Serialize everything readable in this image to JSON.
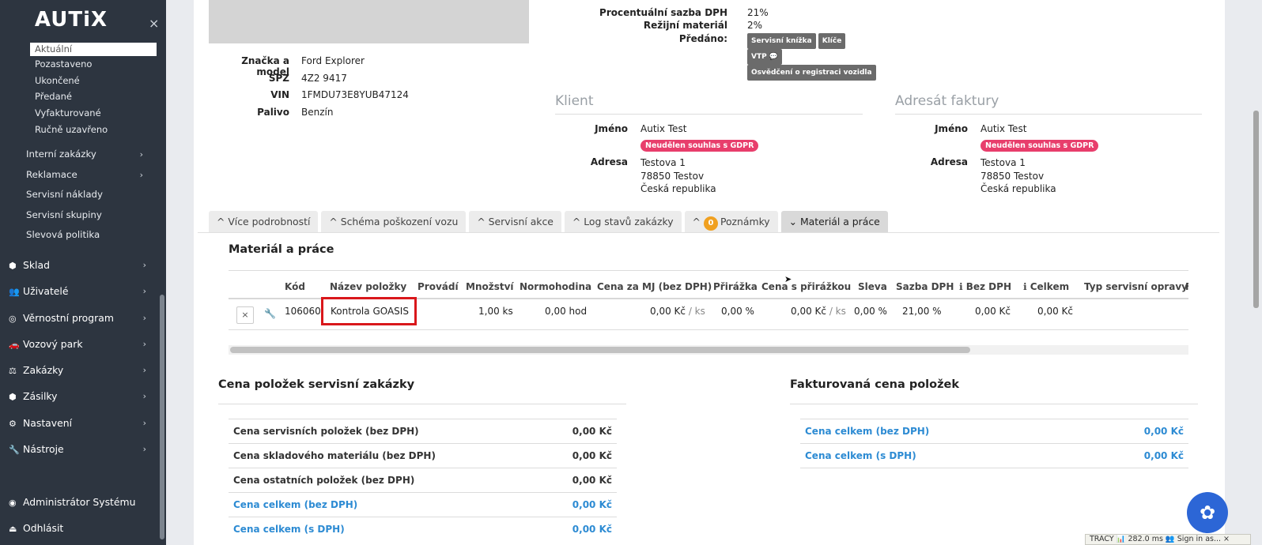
{
  "sidebar": {
    "logo": "AUTiX",
    "close": "×",
    "sub_items": [
      "Aktuální",
      "Pozastaveno",
      "Ukončené",
      "Předané",
      "Vyfakturované",
      "Ručně uzavřeno"
    ],
    "level2": [
      {
        "label": "Interní zakázky",
        "chev": "›"
      },
      {
        "label": "Reklamace",
        "chev": "›"
      },
      {
        "label": "Servisní náklady"
      },
      {
        "label": "Servisní skupiny"
      },
      {
        "label": "Slevová politika"
      }
    ],
    "main": [
      {
        "label": "Sklad",
        "icon": "⬢"
      },
      {
        "label": "Uživatelé",
        "icon": "👥"
      },
      {
        "label": "Věrnostní program",
        "icon": "◎"
      },
      {
        "label": "Vozový park",
        "icon": "🚗"
      },
      {
        "label": "Zakázky",
        "icon": "⚖"
      },
      {
        "label": "Zásilky",
        "icon": "⬢"
      },
      {
        "label": "Nastavení",
        "icon": "⚙"
      },
      {
        "label": "Nástroje",
        "icon": "🔧"
      }
    ],
    "bottom": [
      {
        "label": "Administrátor Systému",
        "icon": "◉"
      },
      {
        "label": "Odhlásit",
        "icon": "⏏"
      }
    ],
    "chev": "›"
  },
  "vehicle": {
    "brand_label": "Značka a model",
    "brand_value": "Ford Explorer",
    "spz_label": "SPZ",
    "spz_value": "4Z2 9417",
    "vin_label": "VIN",
    "vin_value": "1FMDU73E8YUB47124",
    "fuel_label": "Palivo",
    "fuel_value": "Benzín"
  },
  "top_right": {
    "vat_label": "Procentuální sazba DPH",
    "vat_value": "21%",
    "overhead_label": "Režijní materiál",
    "overhead_value": "2%",
    "handed_label": "Předáno:",
    "handed_badges": [
      "Servisní knížka",
      "Klíče",
      "VTP 💬",
      "Osvědčení o registraci vozidla"
    ]
  },
  "client": {
    "title": "Klient",
    "name_label": "Jméno",
    "name_value": "Autix Test",
    "gdpr": "Neudělen souhlas s GDPR",
    "address_label": "Adresa",
    "address_lines": [
      "Testova 1",
      "78850 Testov",
      "Česká republika"
    ]
  },
  "invoice_to": {
    "title": "Adresát faktury",
    "name_label": "Jméno",
    "name_value": "Autix Test",
    "gdpr": "Neudělen souhlas s GDPR",
    "address_label": "Adresa",
    "address_lines": [
      "Testova 1",
      "78850 Testov",
      "Česká republika"
    ]
  },
  "tabs": [
    {
      "label": "^ Více podrobností"
    },
    {
      "label": "^ Schéma poškození vozu"
    },
    {
      "label": "^ Servisní akce"
    },
    {
      "label": "^ Log stavů zakázky"
    },
    {
      "label": "Poznámky",
      "prefix": "^",
      "count": "0"
    },
    {
      "label": "⌄ Materiál a práce",
      "active": true
    }
  ],
  "materials": {
    "title": "Materiál a práce",
    "headers": [
      "Kód",
      "Název položky",
      "Provádí",
      "Množství",
      "Normohodina",
      "Cena za MJ (bez DPH)",
      "Přirážka",
      "Cena s přirážkou",
      "Sleva",
      "Sazba DPH",
      "ℹ Bez DPH",
      "ℹ Celkem",
      "Typ servisní opravy",
      "F"
    ],
    "row": {
      "delete": "×",
      "code": "106060",
      "name": "Kontrola GOASIS",
      "performer": "",
      "qty": "1,00 ks",
      "hours": "0,00 hod",
      "unit_price": "0,00 Kč",
      "unit_price_suffix": "/ ks",
      "markup": "0,00 %",
      "price_markup": "0,00 Kč",
      "price_markup_suffix": "/ ks",
      "discount": "0,00 %",
      "vat_rate": "21,00 %",
      "no_vat": "0,00 Kč",
      "total": "0,00 Kč"
    }
  },
  "summary_left": {
    "title": "Cena položek servisní zakázky",
    "rows": [
      {
        "label": "Cena servisních položek (bez DPH)",
        "value": "0,00 Kč"
      },
      {
        "label": "Cena skladového materiálu (bez DPH)",
        "value": "0,00 Kč"
      },
      {
        "label": "Cena ostatních položek (bez DPH)",
        "value": "0,00 Kč"
      },
      {
        "label": "Cena celkem (bez DPH)",
        "value": "0,00 Kč",
        "blue": true
      },
      {
        "label": "Cena celkem (s DPH)",
        "value": "0,00 Kč",
        "blue": true
      }
    ]
  },
  "summary_right": {
    "title": "Fakturovaná cena položek",
    "rows": [
      {
        "label": "Cena celkem (bez DPH)",
        "value": "0,00 Kč"
      },
      {
        "label": "Cena celkem (s DPH)",
        "value": "0,00 Kč"
      }
    ]
  },
  "tracy": "TRACY  📊 282.0 ms  👥 Sign in as...  ×",
  "colors": {
    "accent": "#2d8bd3",
    "gdpr": "#e83e6c",
    "sidebar": "#2d3540",
    "highlight": "#d9171b"
  }
}
